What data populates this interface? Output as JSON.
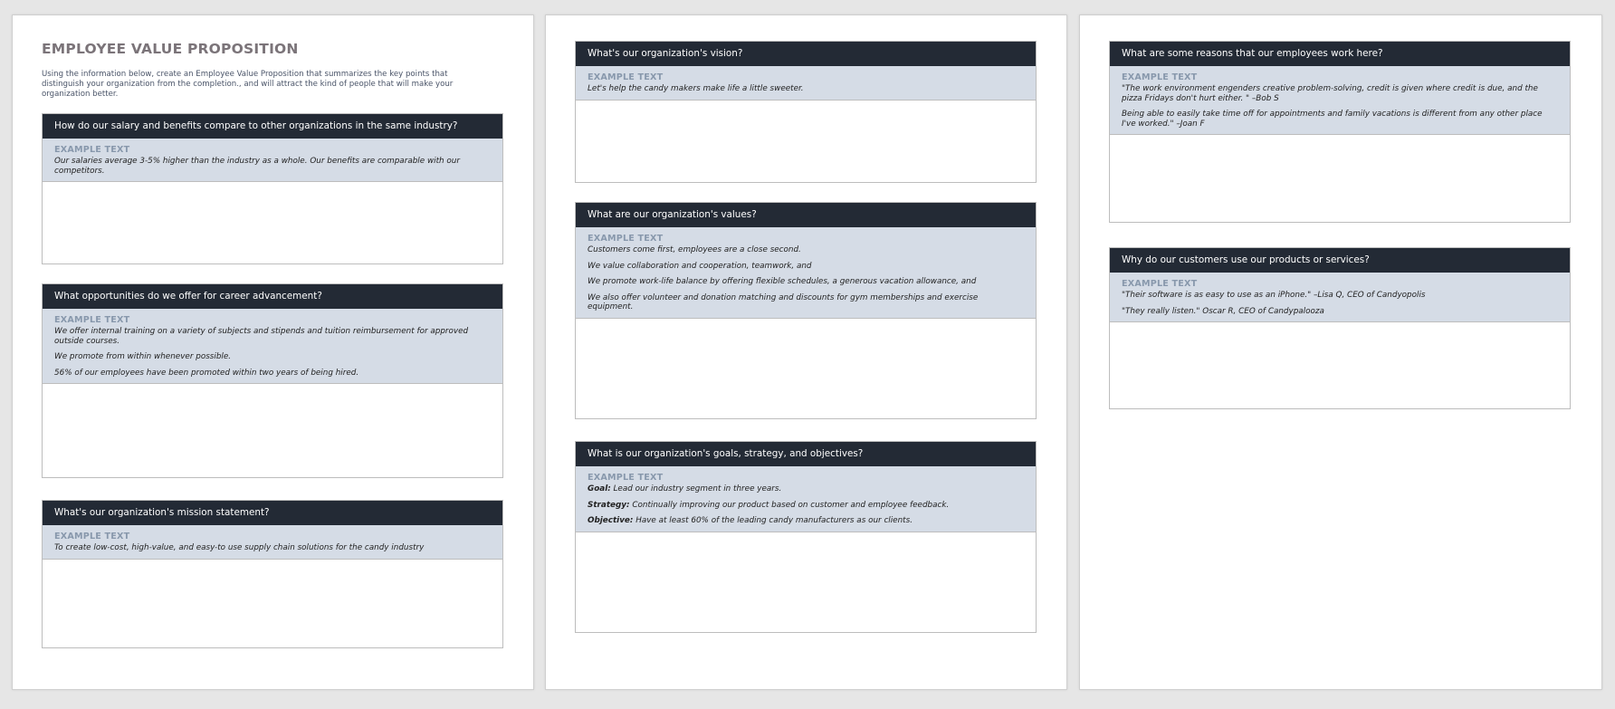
{
  "document": {
    "title": "EMPLOYEE VALUE PROPOSITION",
    "intro": "Using the information below, create an Employee Value Proposition that summarizes the key points that distinguish your organization from the completion., and will attract the kind of people that will make your organization better."
  },
  "example_label": "EXAMPLE TEXT",
  "colors": {
    "header_bg": "#232a35",
    "example_bg": "#d5dce6",
    "example_label": "#8898ac",
    "title": "#7b7479"
  },
  "sections": {
    "salary": {
      "question": "How do our salary and benefits compare to other organizations in the same industry?",
      "lines": [
        "Our salaries average 3-5% higher than the industry as a whole. Our benefits are comparable with our competitors."
      ]
    },
    "career": {
      "question": "What opportunities do we offer for career advancement?",
      "lines": [
        "We offer internal training on a variety of subjects and stipends and tuition reimbursement for approved outside courses.",
        "We promote from within whenever possible.",
        "56% of our employees have been promoted within two years of being hired."
      ]
    },
    "mission": {
      "question": "What's our organization's mission statement?",
      "lines": [
        "To create low-cost, high-value, and easy-to use supply chain solutions for the candy industry"
      ]
    },
    "vision": {
      "question": "What's our organization's vision?",
      "lines": [
        "Let's help the candy makers make life a little sweeter."
      ]
    },
    "values": {
      "question": "What are our organization's values?",
      "lines": [
        "Customers come first, employees are a close second.",
        "We value collaboration and cooperation, teamwork, and",
        "We promote work-life balance by offering flexible schedules, a generous vacation allowance, and",
        "We also offer volunteer and donation matching and discounts for gym memberships and exercise equipment."
      ]
    },
    "goals": {
      "question": "What is our organization's goals, strategy, and objectives?",
      "items": [
        {
          "label": "Goal:",
          "text": " Lead our industry segment in three years."
        },
        {
          "label": "Strategy:",
          "text": " Continually improving our product based on customer and employee feedback."
        },
        {
          "label": "Objective:",
          "text": " Have at least 60% of the leading candy manufacturers as our clients."
        }
      ]
    },
    "reasons": {
      "question": "What are some reasons that our employees work here?",
      "lines": [
        "\"The work environment engenders creative problem-solving, credit is given where credit is due, and the pizza Fridays don't hurt either. \" –Bob S",
        "Being able to easily take time off for appointments and family vacations is different from any other place I've worked.\" –Joan F"
      ]
    },
    "customers": {
      "question": "Why do our customers use our products or services?",
      "lines": [
        "\"Their software is as easy to use as an iPhone.\" –Lisa Q, CEO of Candyopolis",
        "\"They really listen.\" Oscar R, CEO of Candypalooza"
      ]
    }
  }
}
